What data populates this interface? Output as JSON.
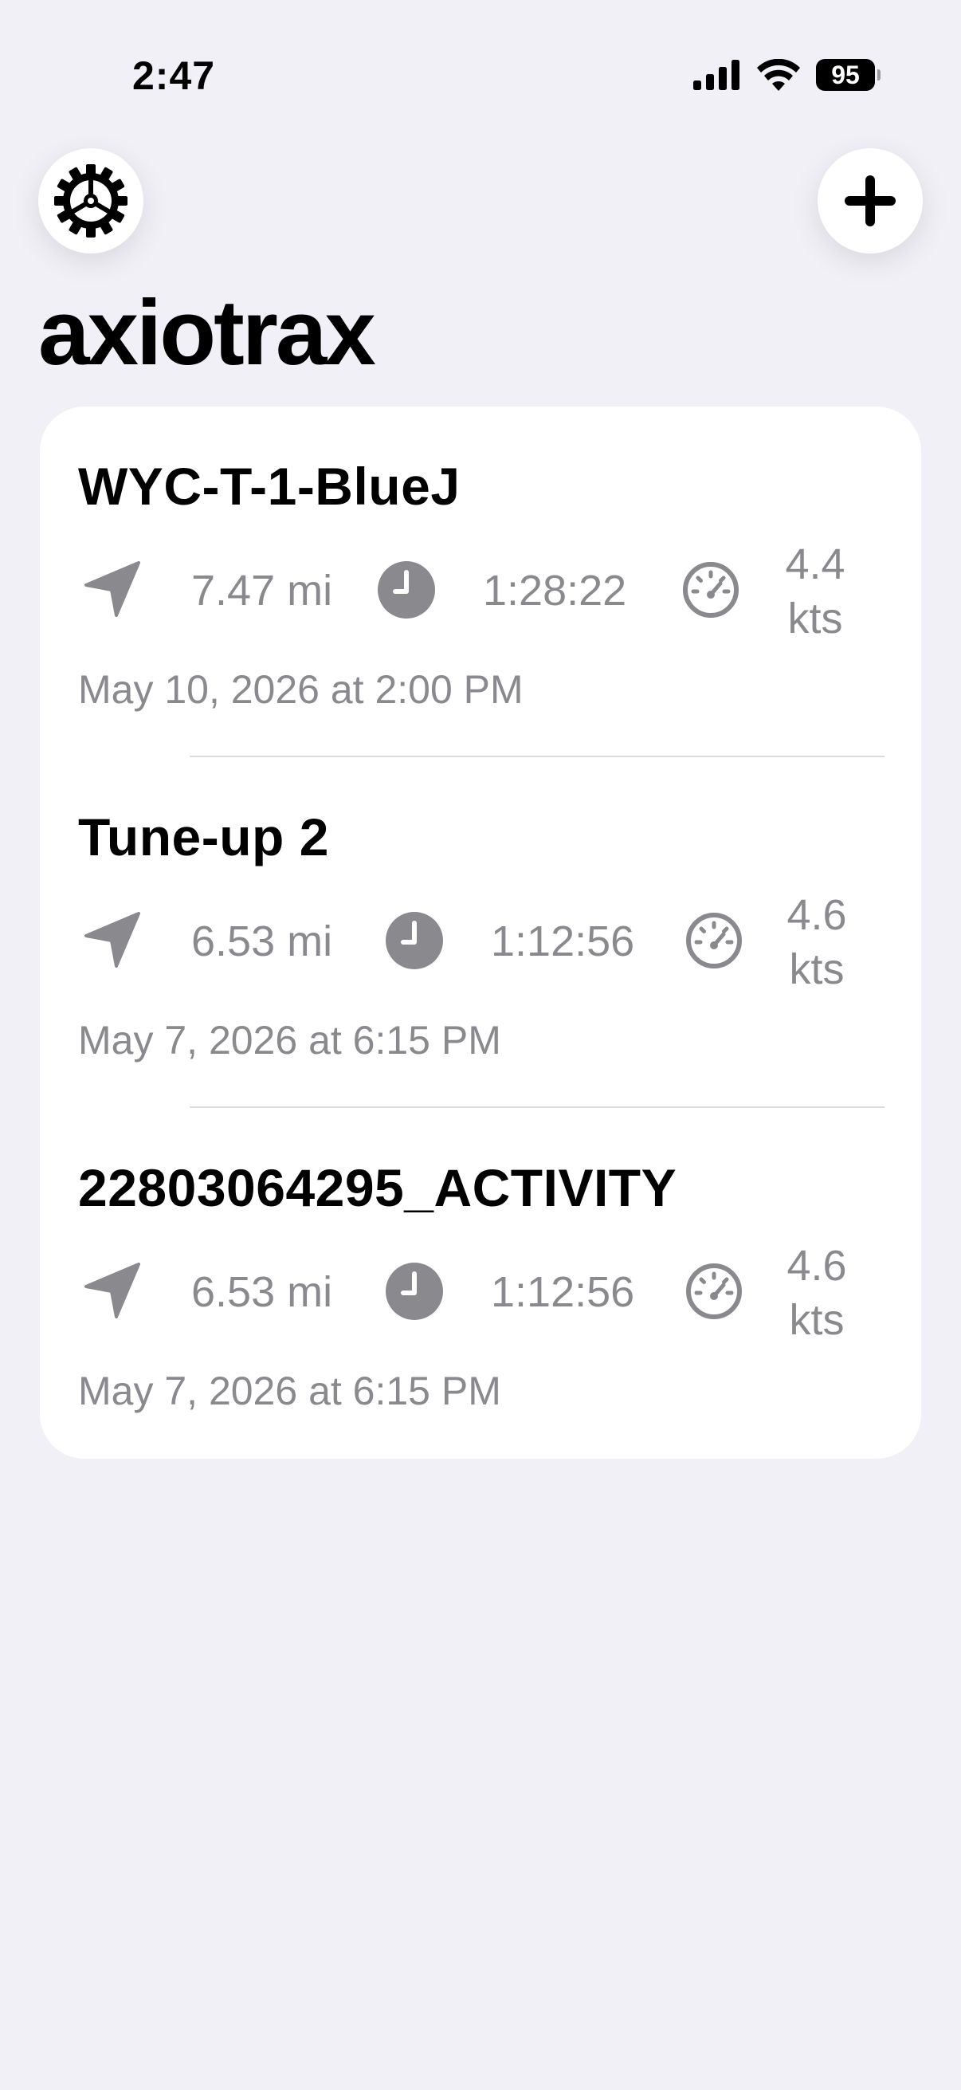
{
  "status_bar": {
    "time": "2:47",
    "battery": "95"
  },
  "header": {
    "title": "axiotrax",
    "settings_icon": "gear-icon",
    "add_icon": "plus-icon"
  },
  "activities": [
    {
      "name": "WYC-T-1-BlueJ",
      "distance": "7.47 mi",
      "duration": "1:28:22",
      "speed_value": "4.4",
      "speed_unit": "kts",
      "date": "May 10, 2026 at 2:00 PM"
    },
    {
      "name": "Tune-up 2",
      "distance": "6.53 mi",
      "duration": "1:12:56",
      "speed_value": "4.6",
      "speed_unit": "kts",
      "date": "May 7, 2026 at 6:15 PM"
    },
    {
      "name": "22803064295_ACTIVITY",
      "distance": "6.53 mi",
      "duration": "1:12:56",
      "speed_value": "4.6",
      "speed_unit": "kts",
      "date": "May 7, 2026 at 6:15 PM"
    }
  ],
  "colors": {
    "background": "#f1f0f6",
    "card": "#ffffff",
    "secondary_text": "#8a8a8e",
    "icon_gray": "#8a8a8e"
  }
}
